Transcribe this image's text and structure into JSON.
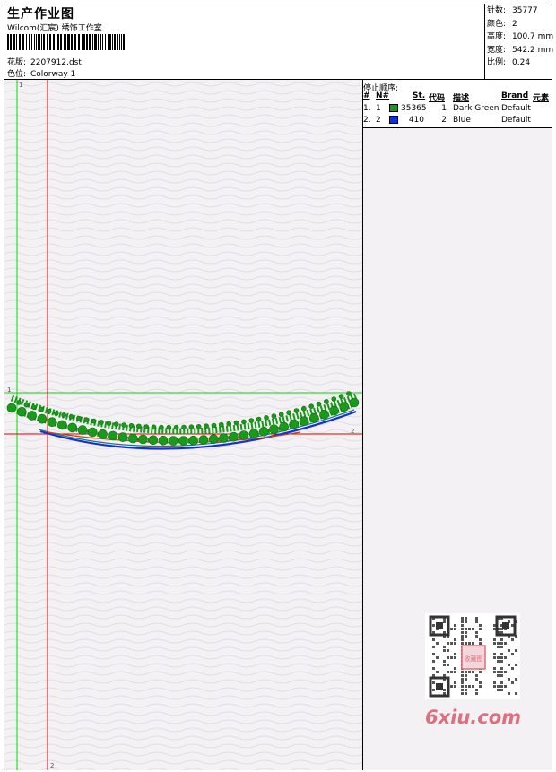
{
  "header": {
    "title": "生产作业图",
    "company": "Wilcom(汇宸) 绣饰工作室",
    "design_label": "花版:",
    "design_value": "2207912.dst",
    "colorway_label": "色位:",
    "colorway_value": "Colorway 1"
  },
  "stats": {
    "stitches_label": "针数:",
    "stitches_value": "35777",
    "colors_label": "颜色:",
    "colors_value": "2",
    "height_label": "高度:",
    "height_value": "100.7 mm",
    "width_label": "宽度:",
    "width_value": "542.2 mm",
    "scale_label": "比例:",
    "scale_value": "0.24"
  },
  "stop_sequence": {
    "title": "停止顺序:",
    "headers": {
      "num": "#",
      "n": "N#",
      "st": "St.",
      "code": "代码",
      "desc": "描述",
      "brand": "Brand",
      "element": "元素"
    },
    "rows": [
      {
        "num": "1.",
        "n": "1",
        "color": "#1a9a1a",
        "st": "35365",
        "code": "1",
        "desc": "Dark Green",
        "brand": "Default"
      },
      {
        "num": "2.",
        "n": "2",
        "color": "#1030e0",
        "st": "410",
        "code": "2",
        "desc": "Blue",
        "brand": "Default"
      }
    ]
  },
  "canvas": {
    "marker_1_top": "1",
    "marker_1_left": "1",
    "marker_2_right": "2",
    "marker_2_bottom": "2"
  },
  "watermark": {
    "logo_text": "6xiu.com",
    "stamp_text": "收藏图"
  },
  "colors": {
    "thread_green": "#1a9a1a",
    "thread_blue": "#1030e0",
    "guide_green": "#00dd00",
    "guide_red": "#dd0000",
    "canvas_bg": "#f3f1f4"
  }
}
